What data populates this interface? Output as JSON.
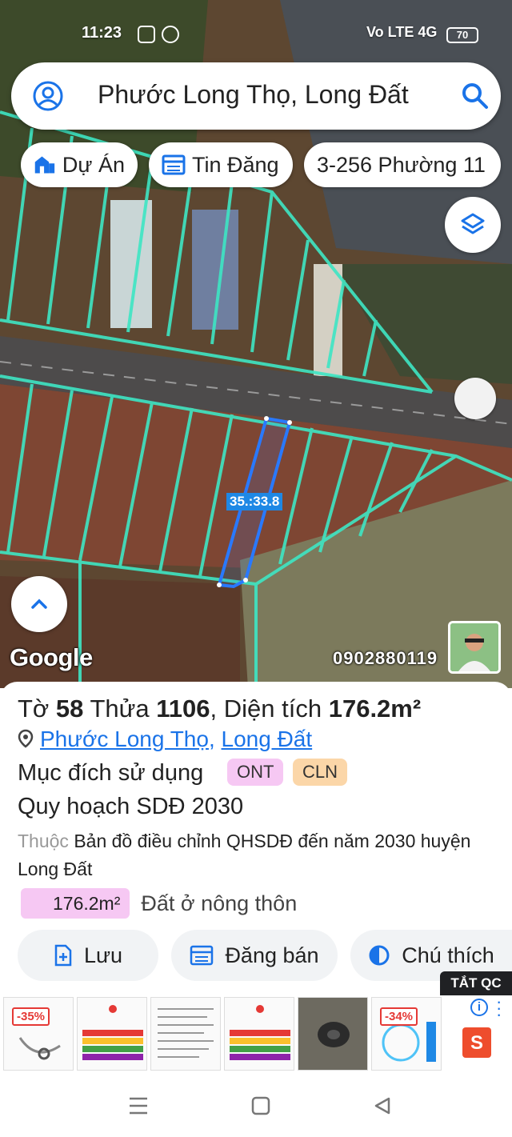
{
  "status": {
    "time": "11:23",
    "network": "Vo LTE 4G",
    "battery": "70"
  },
  "search": {
    "query": "Phước Long Thọ, Long Đất"
  },
  "chips": [
    {
      "label": "Dự Án",
      "icon": "building-icon"
    },
    {
      "label": "Tin Đăng",
      "icon": "listing-icon"
    },
    {
      "label": "3-256 Phường 11",
      "icon": ""
    }
  ],
  "map": {
    "dimension_label": "35.:33.8",
    "attribution": "Google",
    "phone": "0902880119",
    "colors": {
      "parcel_lines": "#3ee6c4",
      "selected_parcel": "#2979ff"
    }
  },
  "parcel": {
    "to_label": "Tờ",
    "to_value": "58",
    "thua_label": "Thửa",
    "thua_value": "1106",
    "area_label": "Diện tích",
    "area_value": "176.2m²",
    "location_ward": "Phước Long Thọ",
    "location_district": "Long Đất",
    "purpose_label": "Mục đích sử dụng",
    "purpose_tags": [
      {
        "label": "ONT",
        "color": "#f6c8f3"
      },
      {
        "label": "CLN",
        "color": "#fbd6a8"
      }
    ],
    "plan_title": "Quy hoạch SDĐ 2030",
    "belongs_label": "Thuộc",
    "belongs_value": "Bản đồ điều chỉnh QHSDĐ đến năm 2030 huyện Long Đất",
    "area_pill": "176.2m²",
    "area_desc": "Đất ở nông thôn"
  },
  "actions": {
    "save": "Lưu",
    "post_sale": "Đăng bán",
    "legend": "Chú thích"
  },
  "ads": {
    "hide_label": "TẮT QC",
    "badges": [
      "-35%",
      "-34%"
    ]
  }
}
